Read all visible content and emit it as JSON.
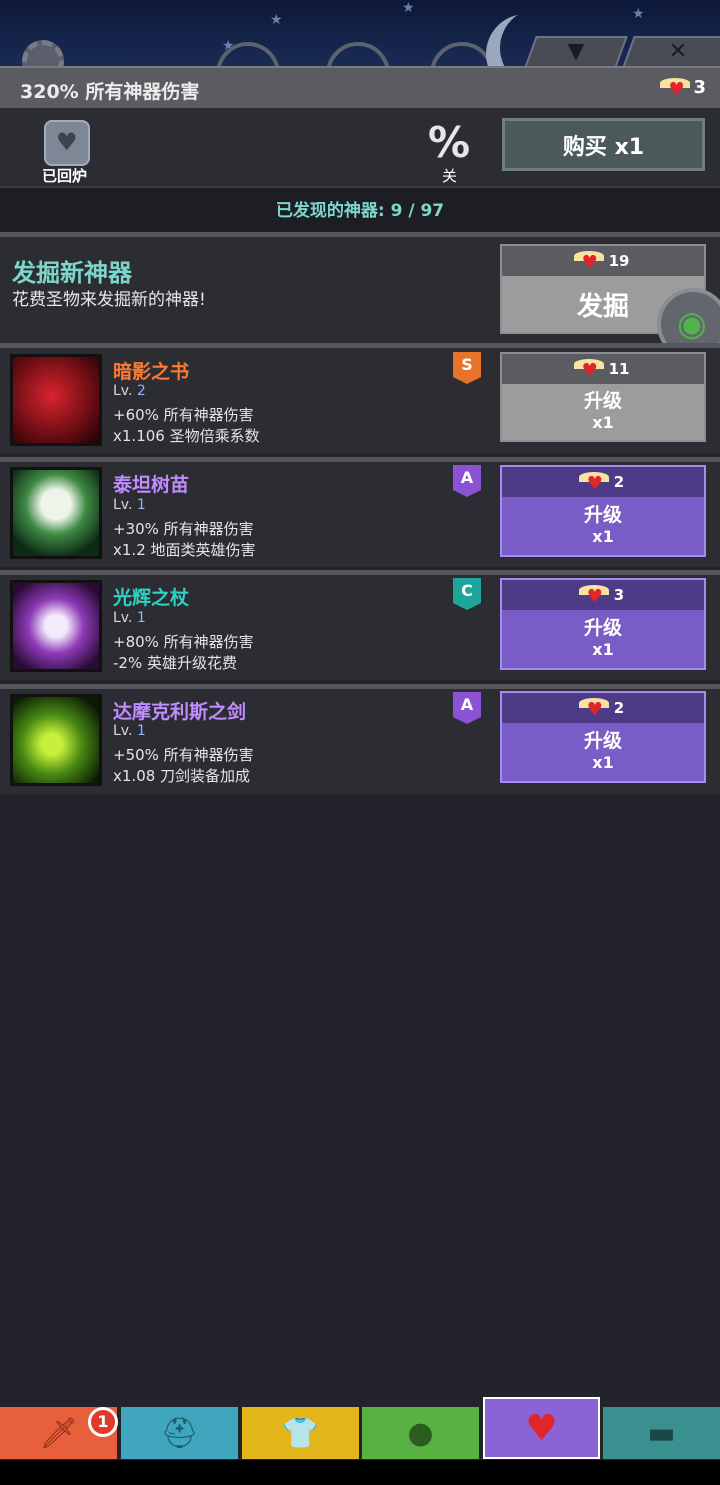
{
  "header": {
    "bonus_text": "320% 所有神器伤害",
    "relic_count": "3"
  },
  "furnace": {
    "label": "已回炉",
    "percent_symbol": "%",
    "percent_label": "关",
    "buy_label": "购买 x1"
  },
  "found_text": "已发现的神器: 9 / 97",
  "dig": {
    "title": "发掘新神器",
    "subtitle": "花费圣物来发掘新的神器!",
    "cost": "19",
    "button": "发掘"
  },
  "items": [
    {
      "name": "暗影之书",
      "lv_prefix": "Lv.",
      "lv": "2",
      "effect1": "+60% 所有神器伤害",
      "effect2": "x1.106 圣物倍乘系数",
      "grade": "S",
      "cost": "11",
      "btn_label": "升级",
      "btn_qty": "x1",
      "name_color": "#ff7a2e",
      "grade_color": "#e8742a"
    },
    {
      "name": "泰坦树苗",
      "lv_prefix": "Lv.",
      "lv": "1",
      "effect1": "+30% 所有神器伤害",
      "effect2": "x1.2 地面类英雄伤害",
      "grade": "A",
      "cost": "2",
      "btn_label": "升级",
      "btn_qty": "x1",
      "name_color": "#c08cff",
      "grade_color": "#8b52d6"
    },
    {
      "name": "光辉之杖",
      "lv_prefix": "Lv.",
      "lv": "1",
      "effect1": "+80% 所有神器伤害",
      "effect2": "-2% 英雄升级花费",
      "grade": "C",
      "cost": "3",
      "btn_label": "升级",
      "btn_qty": "x1",
      "name_color": "#2fd2c3",
      "grade_color": "#1fa69c"
    },
    {
      "name": "达摩克利斯之剑",
      "lv_prefix": "Lv.",
      "lv": "1",
      "effect1": "+50% 所有神器伤害",
      "effect2": "x1.08 刀剑装备加成",
      "grade": "A",
      "cost": "2",
      "btn_label": "升级",
      "btn_qty": "x1",
      "name_color": "#c08cff",
      "grade_color": "#8b52d6"
    }
  ],
  "tabs": [
    {
      "icon": "sword-icon",
      "color": "#e8603b"
    },
    {
      "icon": "helmet-icon",
      "color": "#3fa6be"
    },
    {
      "icon": "shirt-icon",
      "color": "#e2b51a"
    },
    {
      "icon": "pet-icon",
      "color": "#58b142"
    },
    {
      "icon": "heart-artifact-icon",
      "color": "#8a63d6"
    },
    {
      "icon": "shop-icon",
      "color": "#3a8f8f"
    }
  ],
  "tab_badge": "1"
}
